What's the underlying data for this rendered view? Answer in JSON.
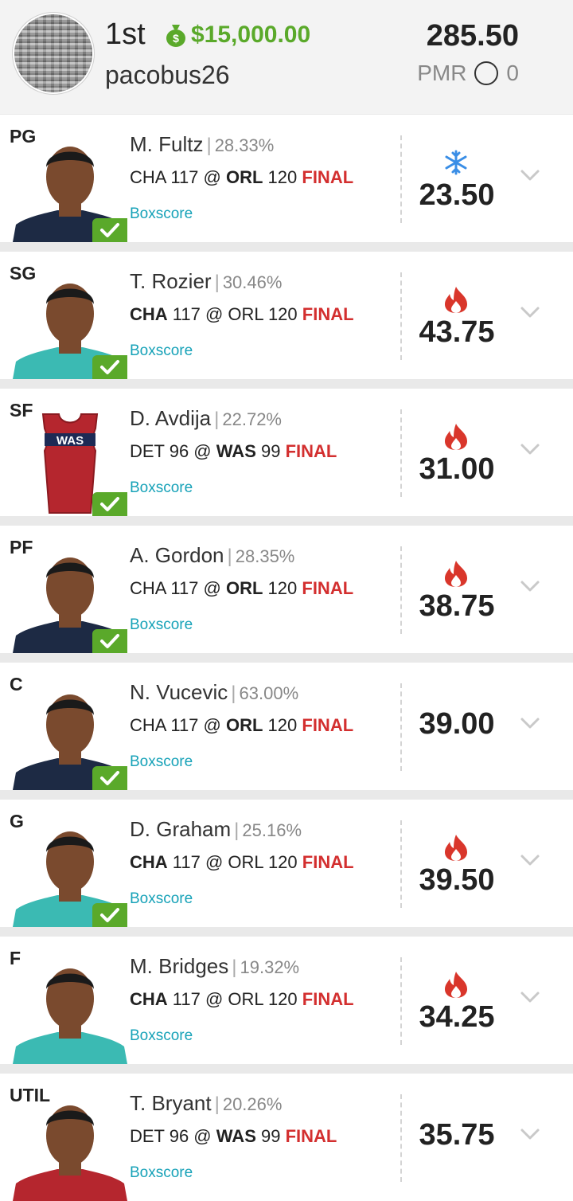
{
  "header": {
    "rank": "1st",
    "prize": "$15,000.00",
    "username": "pacobus26",
    "total_points": "285.50",
    "pmr_label": "PMR",
    "pmr_value": "0"
  },
  "players": [
    {
      "position": "PG",
      "name": "M. Fultz",
      "ownership": "28.33%",
      "game_parts": [
        "CHA 117 @ ",
        "ORL",
        " 120 "
      ],
      "game_bold": "orl",
      "status": "FINAL",
      "boxscore": "Boxscore",
      "score": "23.50",
      "indicator": "snowflake-icon",
      "checked": true,
      "jersey": "#1d2a44"
    },
    {
      "position": "SG",
      "name": "T. Rozier",
      "ownership": "30.46%",
      "game_parts": [
        "CHA",
        " 117 @ ORL 120 "
      ],
      "status": "FINAL",
      "boxscore": "Boxscore",
      "score": "43.75",
      "indicator": "fire-icon",
      "checked": true,
      "jersey": "#3bbab3"
    },
    {
      "position": "SF",
      "name": "D. Avdija",
      "ownership": "22.72%",
      "game_parts": [
        "DET 96 @ ",
        "WAS",
        " 99 "
      ],
      "status": "FINAL",
      "boxscore": "Boxscore",
      "score": "31.00",
      "indicator": "fire-icon",
      "checked": true,
      "jersey": "#b5262e",
      "jersey_text": "WAS"
    },
    {
      "position": "PF",
      "name": "A. Gordon",
      "ownership": "28.35%",
      "game_parts": [
        "CHA 117 @ ",
        "ORL",
        " 120 "
      ],
      "status": "FINAL",
      "boxscore": "Boxscore",
      "score": "38.75",
      "indicator": "fire-icon",
      "checked": true,
      "jersey": "#1d2a44"
    },
    {
      "position": "C",
      "name": "N. Vucevic",
      "ownership": "63.00%",
      "game_parts": [
        "CHA 117 @ ",
        "ORL",
        " 120 "
      ],
      "status": "FINAL",
      "boxscore": "Boxscore",
      "score": "39.00",
      "indicator": "none",
      "checked": true,
      "jersey": "#1d2a44"
    },
    {
      "position": "G",
      "name": "D. Graham",
      "ownership": "25.16%",
      "game_parts": [
        "CHA",
        " 117 @ ORL 120 "
      ],
      "status": "FINAL",
      "boxscore": "Boxscore",
      "score": "39.50",
      "indicator": "fire-icon",
      "checked": true,
      "jersey": "#3bbab3"
    },
    {
      "position": "F",
      "name": "M. Bridges",
      "ownership": "19.32%",
      "game_parts": [
        "CHA",
        " 117 @ ORL 120 "
      ],
      "status": "FINAL",
      "boxscore": "Boxscore",
      "score": "34.25",
      "indicator": "fire-icon",
      "checked": false,
      "jersey": "#3bbab3"
    },
    {
      "position": "UTIL",
      "name": "T. Bryant",
      "ownership": "20.26%",
      "game_parts": [
        "DET 96 @ ",
        "WAS",
        " 99 "
      ],
      "status": "FINAL",
      "boxscore": "Boxscore",
      "score": "35.75",
      "indicator": "none",
      "checked": false,
      "jersey": "#b5262e"
    }
  ]
}
